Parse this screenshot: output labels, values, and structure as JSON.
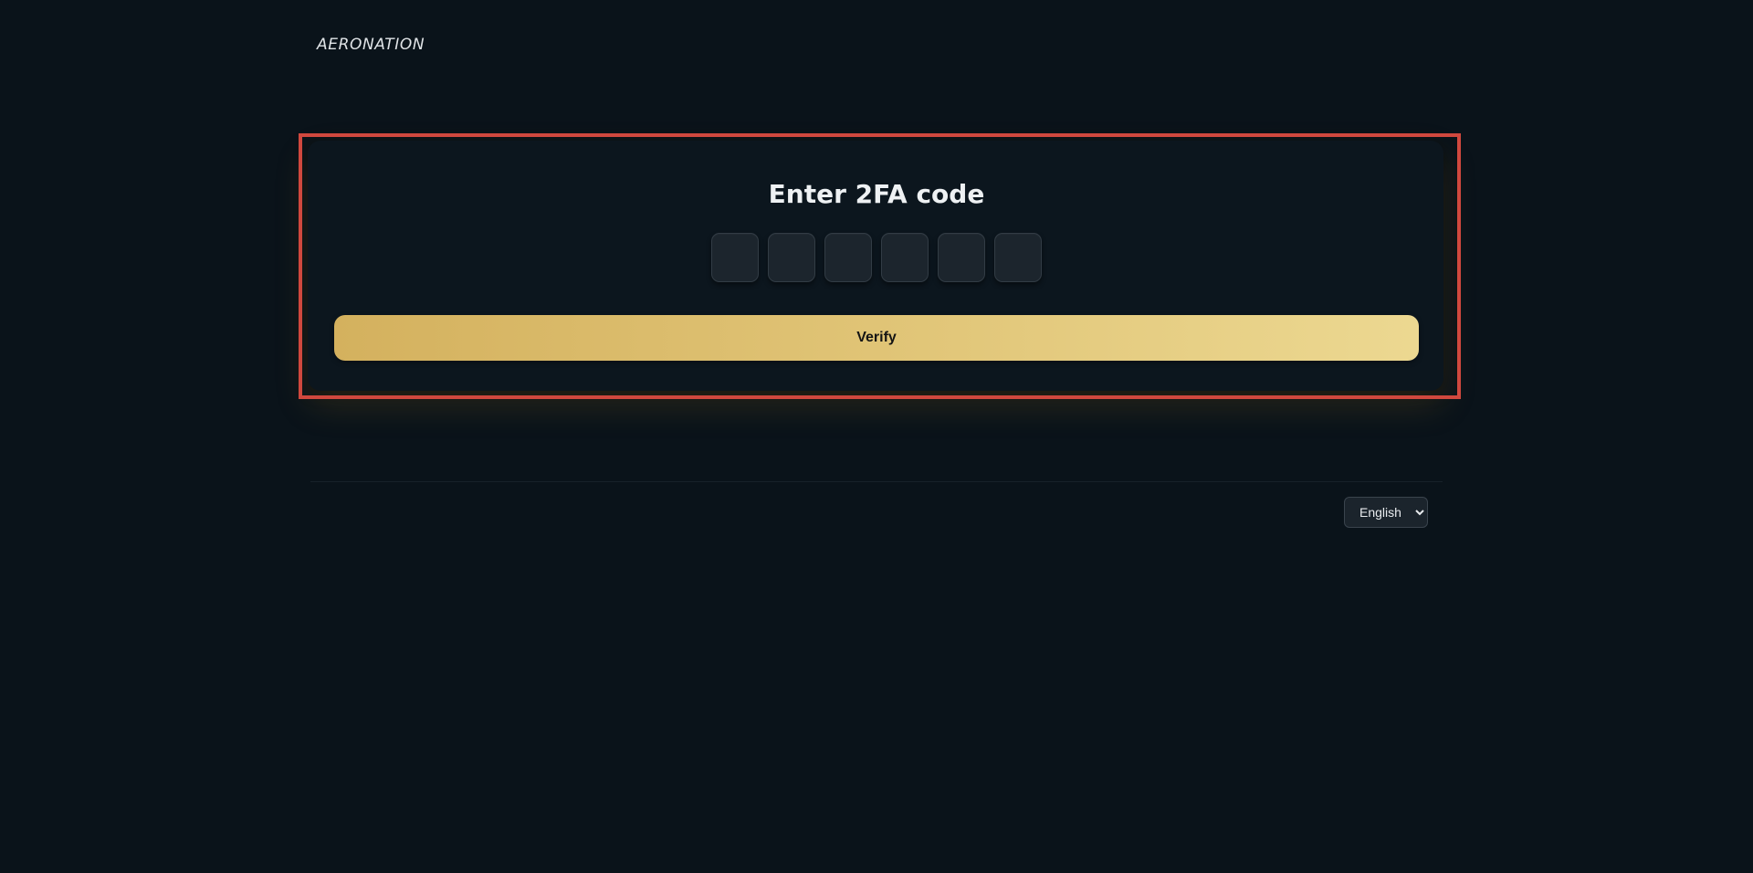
{
  "brand": {
    "logo_text": "AERONATION"
  },
  "twofa": {
    "title": "Enter 2FA code",
    "digits": [
      "",
      "",
      "",
      "",
      "",
      ""
    ],
    "verify_label": "Verify"
  },
  "footer": {
    "language": {
      "selected": "English",
      "options": [
        "English"
      ]
    }
  },
  "colors": {
    "background": "#0a131a",
    "card": "#0c161e",
    "accent_gradient_start": "#d4b15e",
    "accent_gradient_end": "#ecd891",
    "highlight_frame": "#d0483e"
  }
}
